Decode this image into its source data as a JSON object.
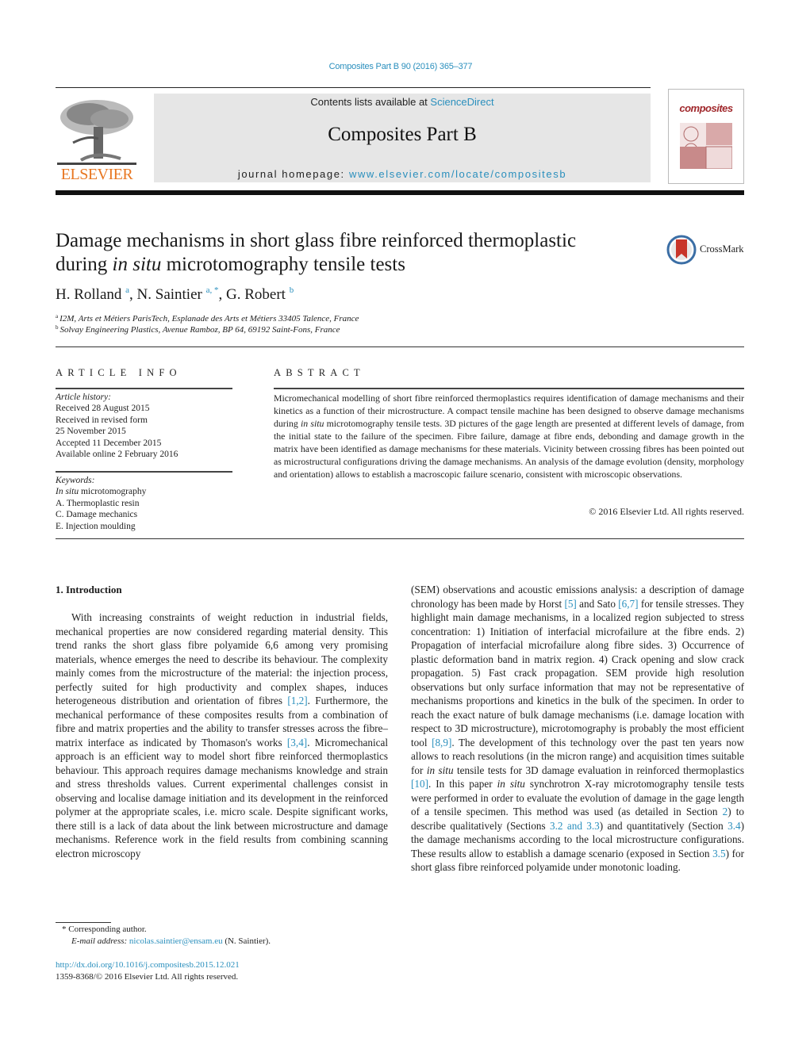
{
  "header": {
    "citation": "Composites Part B 90 (2016) 365–377",
    "contents_prefix": "Contents lists available at ",
    "contents_link": "ScienceDirect",
    "journal_title": "Composites Part B",
    "homepage_prefix": "journal homepage: ",
    "homepage_link": "www.elsevier.com/locate/compositesb",
    "publisher_logo": "ELSEVIER",
    "cover_title": "composites",
    "crossmark_label": "CrossMark"
  },
  "article": {
    "title_line1": "Damage mechanisms in short glass fibre reinforced thermoplastic",
    "title_line2_pre": "during ",
    "title_line2_it": "in situ",
    "title_line2_post": " microtomography tensile tests",
    "authors": [
      {
        "name": "H. Rolland",
        "sup": "a"
      },
      {
        "name": "N. Saintier",
        "sup": "a, *"
      },
      {
        "name": "G. Robert",
        "sup": "b"
      }
    ],
    "affiliations": [
      {
        "mark": "a",
        "text": "I2M, Arts et Métiers ParisTech, Esplanade des Arts et Métiers 33405 Talence, France"
      },
      {
        "mark": "b",
        "text": "Solvay Engineering Plastics, Avenue Ramboz, BP 64, 69192 Saint-Fons, France"
      }
    ]
  },
  "article_info": {
    "heading": "ARTICLE INFO",
    "history_label": "Article history:",
    "history": [
      "Received 28 August 2015",
      "Received in revised form",
      "25 November 2015",
      "Accepted 11 December 2015",
      "Available online 2 February 2016"
    ],
    "keywords_label": "Keywords:",
    "keyword1_it": "In situ",
    "keyword1_rest": " microtomography",
    "keywords": [
      "A. Thermoplastic resin",
      "C. Damage mechanics",
      "E. Injection moulding"
    ]
  },
  "abstract": {
    "heading": "ABSTRACT",
    "p1": "Micromechanical modelling of short fibre reinforced thermoplastics requires identification of damage mechanisms and their kinetics as a function of their microstructure. A compact tensile machine has been designed to observe damage mechanisms during ",
    "p1_it": "in situ",
    "p2": " microtomography tensile tests. 3D pictures of the gage length are presented at different levels of damage, from the initial state to the failure of the specimen. Fibre failure, damage at fibre ends, debonding and damage growth in the matrix have been identified as damage mechanisms for these materials. Vicinity between crossing fibres has been pointed out as microstructural configurations driving the damage mechanisms. An analysis of the damage evolution (density, morphology and orientation) allows to establish a macroscopic failure scenario, consistent with microscopic observations.",
    "copyright": "© 2016 Elsevier Ltd. All rights reserved."
  },
  "intro": {
    "heading": "1.  Introduction",
    "c1_a": "With increasing constraints of weight reduction in industrial fields, mechanical properties are now considered regarding material density. This trend ranks the short glass fibre polyamide 6,6 among very promising materials, whence emerges the need to describe its behaviour. The complexity mainly comes from the microstructure of the material: the injection process, perfectly suited for high productivity and complex shapes, induces heterogeneous distribution and orientation of fibres ",
    "c1_ref1": "[1,2]",
    "c1_b": ". Furthermore, the mechanical performance of these composites results from a combination of fibre and matrix properties and the ability to transfer stresses across the fibre–matrix interface as indicated by Thomason's works ",
    "c1_ref2": "[3,4]",
    "c1_c": ". Micromechanical approach is an efficient way to model short fibre reinforced thermoplastics behaviour. This approach requires damage mechanisms knowledge and strain and stress thresholds values. Current experimental challenges consist in observing and localise damage initiation and its development in the reinforced polymer at the appropriate scales, i.e. micro scale. Despite significant works, there still is a lack of data about the link between microstructure and damage mechanisms. Reference work in the field results from combining scanning electron microscopy",
    "c2_a": "(SEM) observations and acoustic emissions analysis: a description of damage chronology has been made by Horst ",
    "c2_ref1": "[5]",
    "c2_b": " and Sato ",
    "c2_ref2": "[6,7]",
    "c2_c": " for tensile stresses. They highlight main damage mechanisms, in a localized region subjected to stress concentration: 1) Initiation of interfacial microfailure at the fibre ends. 2) Propagation of interfacial microfailure along fibre sides. 3) Occurrence of plastic deformation band in matrix region. 4) Crack opening and slow crack propagation. 5) Fast crack propagation. SEM provide high resolution observations but only surface information that may not be representative of mechanisms proportions and kinetics in the bulk of the specimen. In order to reach the exact nature of bulk damage mechanisms (i.e. damage location with respect to 3D microstructure), microtomography is probably the most efficient tool ",
    "c2_ref3": "[8,9]",
    "c2_d": ". The development of this technology over the past ten years now allows to reach resolutions (in the micron range) and acquisition times suitable for ",
    "c2_it1": "in situ",
    "c2_e": " tensile tests for 3D damage evaluation in reinforced thermoplastics ",
    "c2_ref4": "[10]",
    "c2_f": ". In this paper ",
    "c2_it2": "in situ",
    "c2_g": " synchrotron X-ray microtomography tensile tests were performed in order to evaluate the evolution of damage in the gage length of a tensile specimen. This method was used (as detailed in Section ",
    "c2_ref5": "2",
    "c2_h": ") to describe qualitatively (Sections ",
    "c2_ref6": "3.2 and 3.3",
    "c2_i": ") and quantitatively (Section ",
    "c2_ref7": "3.4",
    "c2_j": ") the damage mechanisms according to the local microstructure configurations. These results allow to establish a damage scenario (exposed in Section ",
    "c2_ref8": "3.5",
    "c2_k": ") for short glass fibre reinforced polyamide under monotonic loading."
  },
  "footnotes": {
    "corresponding": "* Corresponding author.",
    "email_label": "E-mail address: ",
    "email": "nicolas.saintier@ensam.eu",
    "email_suffix": " (N. Saintier).",
    "doi": "http://dx.doi.org/10.1016/j.compositesb.2015.12.021",
    "issn": "1359-8368/© 2016 Elsevier Ltd. All rights reserved."
  },
  "colors": {
    "link": "#2a8fbd",
    "elsevier_orange": "#e87722",
    "banner_bg": "#e6e6e6",
    "cover_red": "#a0282c"
  }
}
